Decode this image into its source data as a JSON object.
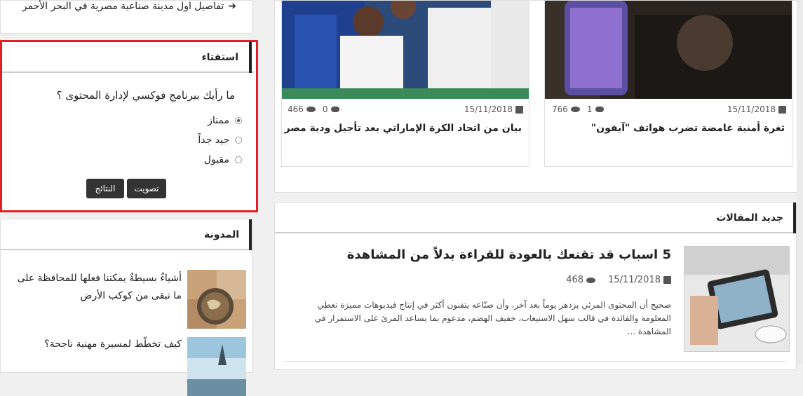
{
  "top_link": {
    "text": "تفاصيل اول مدينة صناعية مصرية في البحر الأحمر"
  },
  "poll": {
    "heading": "استفتاء",
    "question": "ما رأيك ببرنامج فوكسي لإدارة المحتوى ؟",
    "options": [
      {
        "label": "ممتاز",
        "selected": true
      },
      {
        "label": "جيد جداً",
        "selected": false
      },
      {
        "label": "مقبول",
        "selected": false
      }
    ],
    "vote_label": "تصويت",
    "results_label": "النتائج",
    "accent_color": "#e31e24"
  },
  "blog": {
    "heading": "المدونة",
    "items": [
      {
        "title": "أشياءٌ بسيطةٌ يمكننا فعلها للمحافظة على ما تبقى من كوكب الأرض"
      },
      {
        "title": "كيف تخطّط لمسيرة مهنية ناجحة؟"
      }
    ]
  },
  "news_cards": [
    {
      "date": "15/11/2018",
      "comments": "0",
      "views": "466",
      "title": "بيان من اتحاد الكرة الإماراتي بعد تأجيل ودية مصر"
    },
    {
      "date": "15/11/2018",
      "comments": "1",
      "views": "766",
      "title": "ثغرة أمنية غامضة تضرب هواتف \"آيفون\""
    }
  ],
  "latest_articles": {
    "heading": "جديد المقالات",
    "article": {
      "title": "5 اسباب قد تقنعك بالعودة للقراءة بدلاً من المشاهدة",
      "date": "15/11/2018",
      "views": "468",
      "excerpt": "صحيح أن المحتوى المرئي يزدهر يوماً بعد آخر، وأن صنّاعه يتفنون أكثر في إنتاج فيديوهات مميزة تعطي المعلومة والفائدة في قالب سهل الاستيعاب، خفيف الهضم، مدعوم بما يساعد المرئ على الاستمرار في المشاهدة ..."
    }
  }
}
